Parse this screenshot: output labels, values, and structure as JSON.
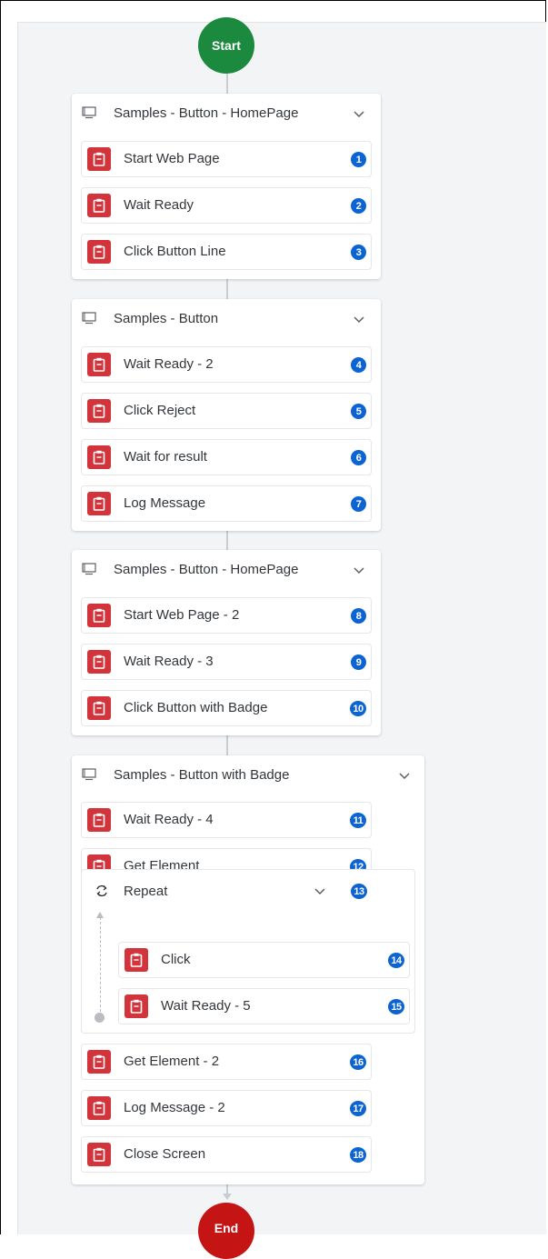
{
  "start_label": "Start",
  "end_label": "End",
  "groups": [
    {
      "title": "Samples - Button - HomePage",
      "steps": [
        {
          "label": "Start Web Page",
          "n": "1"
        },
        {
          "label": "Wait Ready",
          "n": "2"
        },
        {
          "label": "Click Button Line",
          "n": "3"
        }
      ]
    },
    {
      "title": "Samples - Button",
      "steps": [
        {
          "label": "Wait Ready - 2",
          "n": "4"
        },
        {
          "label": "Click Reject",
          "n": "5"
        },
        {
          "label": "Wait for result",
          "n": "6"
        },
        {
          "label": "Log Message",
          "n": "7"
        }
      ]
    },
    {
      "title": "Samples - Button - HomePage",
      "steps": [
        {
          "label": "Start Web Page - 2",
          "n": "8"
        },
        {
          "label": "Wait Ready - 3",
          "n": "9"
        },
        {
          "label": "Click Button with Badge",
          "n": "10"
        }
      ]
    },
    {
      "title": "Samples - Button with Badge",
      "steps": [
        {
          "label": "Wait Ready - 4",
          "n": "11"
        },
        {
          "label": "Get Element",
          "n": "12"
        }
      ],
      "loop": {
        "title": "Repeat",
        "n": "13",
        "steps": [
          {
            "label": "Click",
            "n": "14"
          },
          {
            "label": "Wait Ready - 5",
            "n": "15"
          }
        ]
      },
      "steps_after": [
        {
          "label": "Get Element - 2",
          "n": "16"
        },
        {
          "label": "Log Message - 2",
          "n": "17"
        },
        {
          "label": "Close Screen",
          "n": "18"
        }
      ]
    }
  ],
  "colors": {
    "start": "#1b8a3e",
    "end": "#c41414",
    "activity": "#d3343b",
    "badge": "#0b64d1"
  },
  "icons": {
    "group": "screen-icon",
    "step": "clipboard-icon",
    "loop": "repeat-icon",
    "collapse": "chevron-down-icon"
  }
}
